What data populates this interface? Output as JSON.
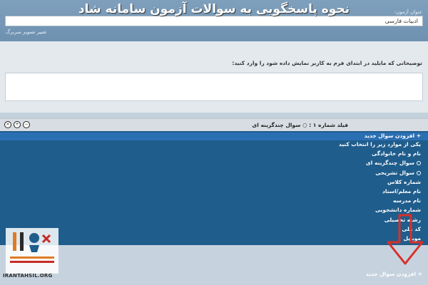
{
  "caption": "نحوه پاسخگویی به سوالات آزمون سامانه شاد",
  "form": {
    "title_label": "عنوان آزمون:",
    "title_value": "ادبیات فارسی",
    "change_cover": "تغییر تصویر سربرگ",
    "desc_label": "توضیحاتی که مایلید در ابتدای فرم به کاربر نمایش داده شود را وارد کنید:"
  },
  "field_bar": {
    "title": "فیلد شماره ۱ : ○ سوال چندگزینه ای",
    "icons": [
      "plus-icon",
      "minus-icon",
      "close-icon"
    ]
  },
  "menu": {
    "add_new_question": "+ افزودن سوال جدید",
    "items": [
      {
        "label": "یکی از موارد زیر را انتخاب کنید",
        "bullet": false
      },
      {
        "label": "نام و نام خانوادگی",
        "bullet": false
      },
      {
        "label": "سوال چندگزینه ای",
        "bullet": true
      },
      {
        "label": "سوال تشریحی",
        "bullet": true
      },
      {
        "label": "شماره کلاس",
        "bullet": false
      },
      {
        "label": "نام معلم/استاد",
        "bullet": false
      },
      {
        "label": "نام مدرسه",
        "bullet": false
      },
      {
        "label": "شماره دانشجویی",
        "bullet": false
      },
      {
        "label": "رشته تحصیلی",
        "bullet": false
      },
      {
        "label": "کد ملی",
        "bullet": false
      },
      {
        "label": "موبایل",
        "bullet": false
      }
    ]
  },
  "bottom": {
    "add_new_question": "+ افزودن سوال جدید"
  },
  "watermark": {
    "brand": "ایران تحصیل",
    "site": "IRANTAHSIL.ORG"
  },
  "colors": {
    "panel": "#1f5d8c",
    "highlight": "#2b6fb3",
    "arrow": "#d9302a"
  }
}
